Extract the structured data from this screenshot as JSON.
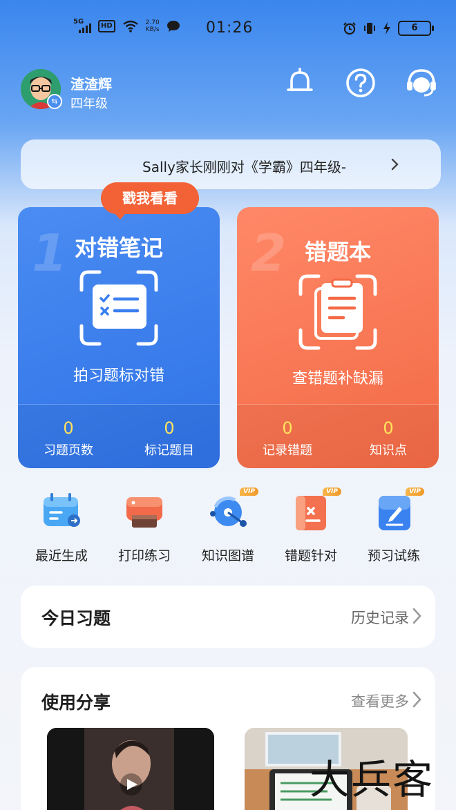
{
  "status_bar": {
    "network": "5G",
    "hd": "HD",
    "speed_value": "2.70",
    "speed_unit": "KB/s",
    "time": "01:26",
    "battery": "6"
  },
  "user": {
    "name": "渣渣辉",
    "grade": "四年级"
  },
  "notice": {
    "text": "Sally家长刚刚对《学霸》四年级-"
  },
  "cards": {
    "bubble": "戳我看看",
    "left": {
      "number": "1",
      "title": "对错笔记",
      "subtitle": "拍习题标对错",
      "stats": [
        {
          "value": "0",
          "label": "习题页数"
        },
        {
          "value": "0",
          "label": "标记题目"
        }
      ]
    },
    "right": {
      "number": "2",
      "title": "错题本",
      "subtitle": "查错题补缺漏",
      "stats": [
        {
          "value": "0",
          "label": "记录错题"
        },
        {
          "value": "0",
          "label": "知识点"
        }
      ]
    }
  },
  "tools": [
    {
      "label": "最近生成",
      "icon": "recent-icon",
      "vip": ""
    },
    {
      "label": "打印练习",
      "icon": "printer-icon",
      "vip": ""
    },
    {
      "label": "知识图谱",
      "icon": "knowledge-graph-icon",
      "vip": "VIP"
    },
    {
      "label": "错题针对",
      "icon": "wrong-question-icon",
      "vip": "VIP"
    },
    {
      "label": "预习试练",
      "icon": "preview-icon",
      "vip": "VIP"
    }
  ],
  "today": {
    "title": "今日习题",
    "link": "历史记录"
  },
  "share": {
    "title": "使用分享",
    "link": "查看更多"
  },
  "watermark": "大兵客",
  "colors": {
    "primary_blue": "#3a7ff0",
    "accent_orange": "#f36a45",
    "stat_yellow": "#ffe35c"
  }
}
